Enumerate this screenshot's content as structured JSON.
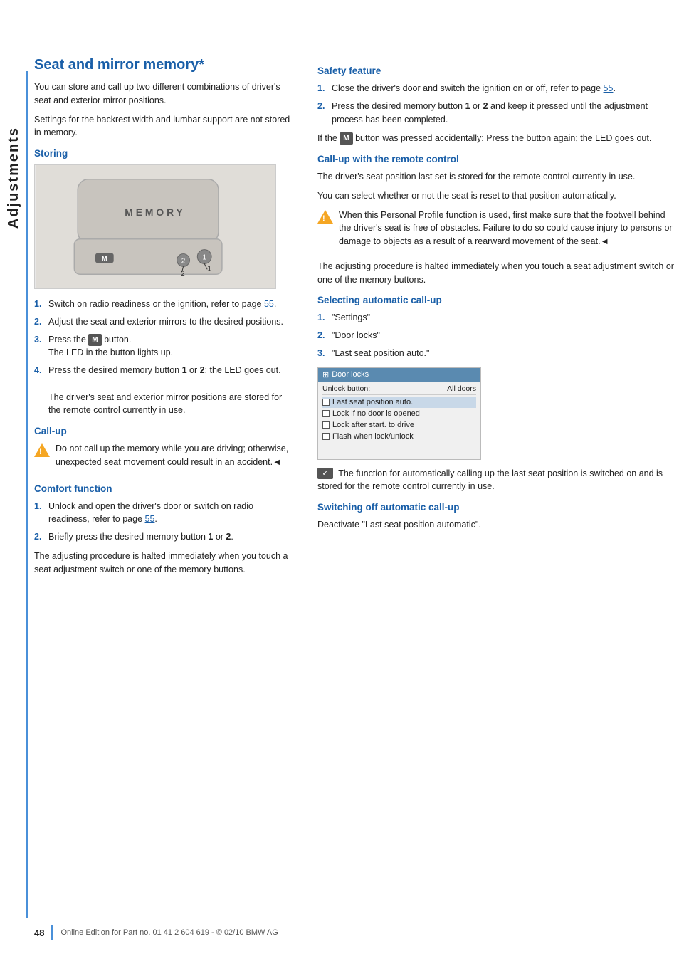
{
  "sidebar": {
    "label": "Adjustments"
  },
  "page": {
    "title": "Seat and mirror memory*",
    "intro": [
      "You can store and call up two different combinations of driver's seat and exterior mirror positions.",
      "Settings for the backrest width and lumbar support are not stored in memory."
    ],
    "image_alt": "Seat memory illustration",
    "image_label": "MEMORY"
  },
  "left_column": {
    "storing_heading": "Storing",
    "storing_steps": [
      {
        "num": "1.",
        "text": "Switch on radio readiness or the ignition, refer to page 55."
      },
      {
        "num": "2.",
        "text": "Adjust the seat and exterior mirrors to the desired positions."
      },
      {
        "num": "3.",
        "text": "Press the M button.\nThe LED in the button lights up."
      },
      {
        "num": "4.",
        "text": "Press the desired memory button 1 or 2: the LED goes out.\n\nThe driver's seat and exterior mirror positions are stored for the remote control currently in use."
      }
    ],
    "callup_heading": "Call-up",
    "callup_warning": "Do not call up the memory while you are driving; otherwise, unexpected seat movement could result in an accident.◄",
    "comfort_heading": "Comfort function",
    "comfort_steps": [
      {
        "num": "1.",
        "text": "Unlock and open the driver's door or switch on radio readiness, refer to page 55."
      },
      {
        "num": "2.",
        "text": "Briefly press the desired memory button 1 or 2."
      }
    ],
    "comfort_note": "The adjusting procedure is halted immediately when you touch a seat adjustment switch or one of the memory buttons."
  },
  "right_column": {
    "safety_heading": "Safety feature",
    "safety_steps": [
      {
        "num": "1.",
        "text": "Close the driver's door and switch the ignition on or off, refer to page 55."
      },
      {
        "num": "2.",
        "text": "Press the desired memory button 1 or 2 and keep it pressed until the adjustment process has been completed."
      }
    ],
    "safety_note": "If the M button was pressed accidentally: Press the button again; the LED goes out.",
    "remote_heading": "Call-up with the remote control",
    "remote_text1": "The driver's seat position last set is stored for the remote control currently in use.",
    "remote_text2": "You can select whether or not the seat is reset to that position automatically.",
    "remote_warning": "When this Personal Profile function is used, first make sure that the footwell behind the driver's seat is free of obstacles. Failure to do so could cause injury to persons or damage to objects as a result of a rearward movement of the seat.◄",
    "remote_note": "The adjusting procedure is halted immediately when you touch a seat adjustment switch or one of the memory buttons.",
    "selecting_heading": "Selecting automatic call-up",
    "selecting_steps": [
      {
        "num": "1.",
        "text": "\"Settings\""
      },
      {
        "num": "2.",
        "text": "\"Door locks\""
      },
      {
        "num": "3.",
        "text": "\"Last seat position auto.\""
      }
    ],
    "door_locks_title": "Door locks",
    "door_locks_top_label": "Unlock button:",
    "door_locks_top_value": "All doors",
    "door_locks_items": [
      {
        "label": "Last seat position auto.",
        "highlighted": true
      },
      {
        "label": "Lock if no door is opened",
        "highlighted": false
      },
      {
        "label": "Lock after start. to drive",
        "highlighted": false
      },
      {
        "label": "Flash when lock/unlock",
        "highlighted": false
      }
    ],
    "auto_callup_note": "The function for automatically calling up the last seat position is switched on and is stored for the remote control currently in use.",
    "switching_off_heading": "Switching off automatic call-up",
    "switching_off_text": "Deactivate \"Last seat position automatic\"."
  },
  "footer": {
    "page_number": "48",
    "footer_text": "Online Edition for Part no. 01 41 2 604 619 - © 02/10 BMW AG"
  }
}
